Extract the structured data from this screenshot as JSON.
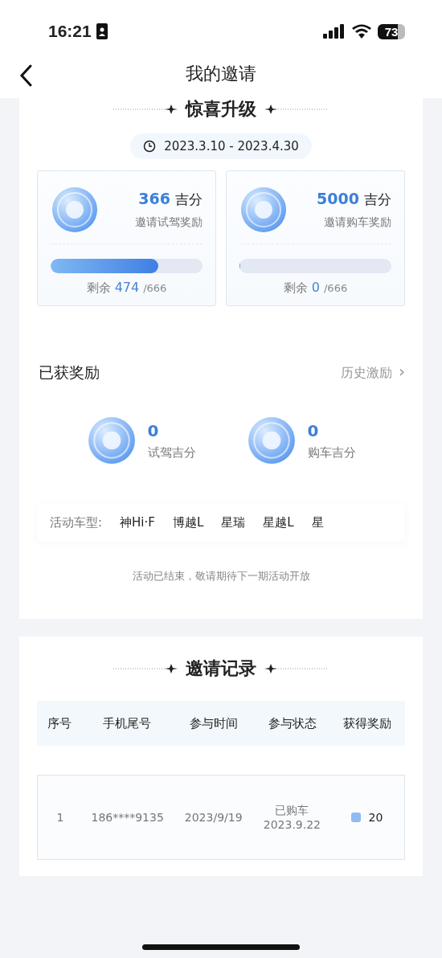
{
  "status_bar": {
    "time": "16:21",
    "battery": "73"
  },
  "header": {
    "title": "我的邀请"
  },
  "upgrade": {
    "title": "惊喜升级",
    "period": "2023.3.10 - 2023.4.30",
    "rewards": [
      {
        "amount": "366",
        "unit": "吉分",
        "label": "邀请试驾奖励",
        "level": 0.71,
        "remaining_label": "剩余",
        "remaining": "474",
        "total": "/666"
      },
      {
        "amount": "5000",
        "unit": "吉分",
        "label": "邀请购车奖励",
        "level": 0,
        "remaining_label": "剩余",
        "remaining": "0",
        "total": "/666"
      }
    ]
  },
  "earned": {
    "title": "已获奖励",
    "history_link": "历史激励",
    "history_arrow": "›",
    "items": [
      {
        "amount": "0",
        "label": "试驾吉分"
      },
      {
        "amount": "0",
        "label": "购车吉分"
      }
    ],
    "models_label": "活动车型:",
    "models": [
      "神Hi·F",
      "博越L",
      "星瑞",
      "星越L",
      "星"
    ],
    "notice": "活动已结束，敬请期待下一期活动开放"
  },
  "records": {
    "title": "邀请记录",
    "columns": [
      "序号",
      "手机尾号",
      "参与时间",
      "参与状态",
      "获得奖励"
    ],
    "rows": [
      {
        "index": "1",
        "phone": "186****9135",
        "time": "2023/9/19",
        "status": "已购车",
        "status_date": "2023.9.22",
        "reward": "20"
      }
    ]
  }
}
